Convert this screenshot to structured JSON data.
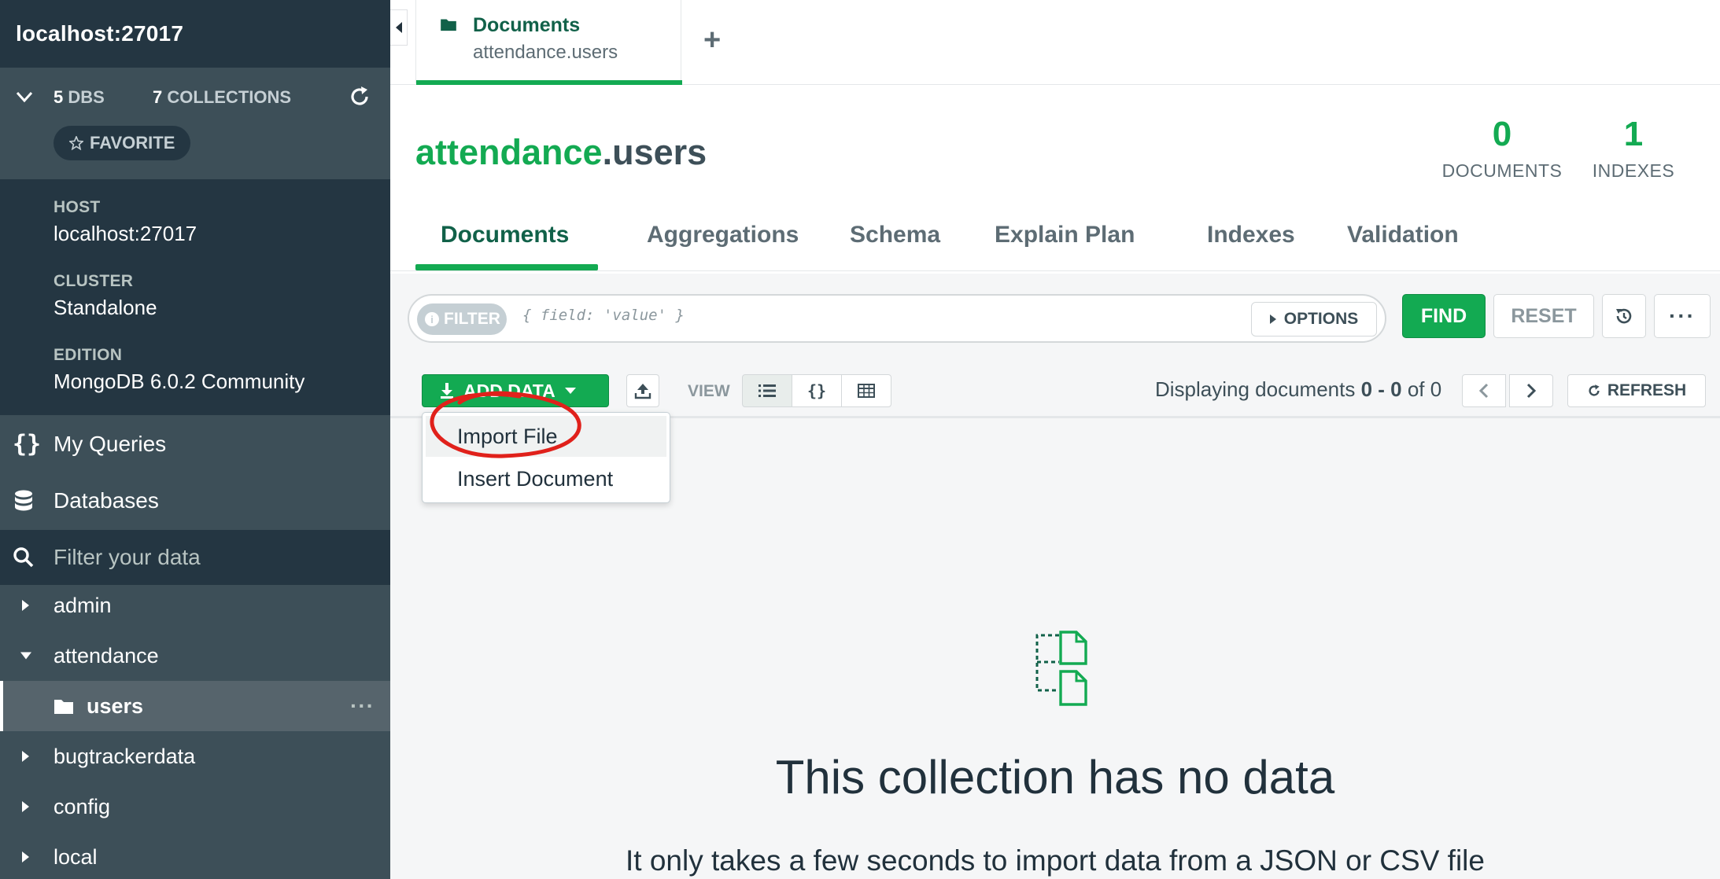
{
  "sidebar": {
    "connection_title": "localhost:27017",
    "dbs_count": "5",
    "dbs_label": "DBS",
    "collections_count": "7",
    "collections_label": "COLLECTIONS",
    "favorite_label": "FAVORITE",
    "info": [
      {
        "label": "HOST",
        "value": "localhost:27017"
      },
      {
        "label": "CLUSTER",
        "value": "Standalone"
      },
      {
        "label": "EDITION",
        "value": "MongoDB 6.0.2 Community"
      }
    ],
    "nav": {
      "my_queries": "My Queries",
      "databases": "Databases"
    },
    "filter_placeholder": "Filter your data",
    "databases": [
      {
        "name": "admin",
        "expanded": false
      },
      {
        "name": "attendance",
        "expanded": true
      },
      {
        "name": "bugtrackerdata",
        "expanded": false
      },
      {
        "name": "config",
        "expanded": false
      },
      {
        "name": "local",
        "expanded": false
      }
    ],
    "active_collection": "users",
    "active_collection_more": "···"
  },
  "workspace_tab": {
    "title": "Documents",
    "subtitle": "attendance.users",
    "add_label": "+"
  },
  "namespace": {
    "db": "attendance",
    "collection": ".users"
  },
  "stats": {
    "documents_count": "0",
    "documents_label": "DOCUMENTS",
    "indexes_count": "1",
    "indexes_label": "INDEXES"
  },
  "subtabs": [
    "Documents",
    "Aggregations",
    "Schema",
    "Explain Plan",
    "Indexes",
    "Validation"
  ],
  "query": {
    "filter_label": "FILTER",
    "filter_placeholder": "{ field: 'value' }",
    "options_label": "OPTIONS",
    "find_label": "FIND",
    "reset_label": "RESET",
    "more_label": "···"
  },
  "toolbar": {
    "add_data_label": "ADD DATA",
    "view_label": "VIEW",
    "view_json_label": "{}",
    "paging_prefix": "Displaying documents ",
    "paging_range": "0 - 0",
    "paging_of": " of ",
    "paging_total": "0",
    "refresh_label": "REFRESH"
  },
  "add_data_menu": [
    "Import File",
    "Insert Document"
  ],
  "empty_state": {
    "title": "This collection has no data",
    "subtitle": "It only takes a few seconds to import data from a JSON or CSV file"
  },
  "colors": {
    "accent": "#13aa52",
    "accent_dark": "#116149",
    "sidebar": "#3d4f58",
    "sidebar_dark": "#243642",
    "annotation": "#e0211b"
  },
  "icons": [
    "chevron-down-icon",
    "refresh-icon",
    "star-icon",
    "braces-icon",
    "database-icon",
    "search-icon",
    "folder-icon",
    "download-icon",
    "upload-icon",
    "list-view-icon",
    "table-view-icon",
    "history-icon",
    "empty-documents-icon"
  ]
}
